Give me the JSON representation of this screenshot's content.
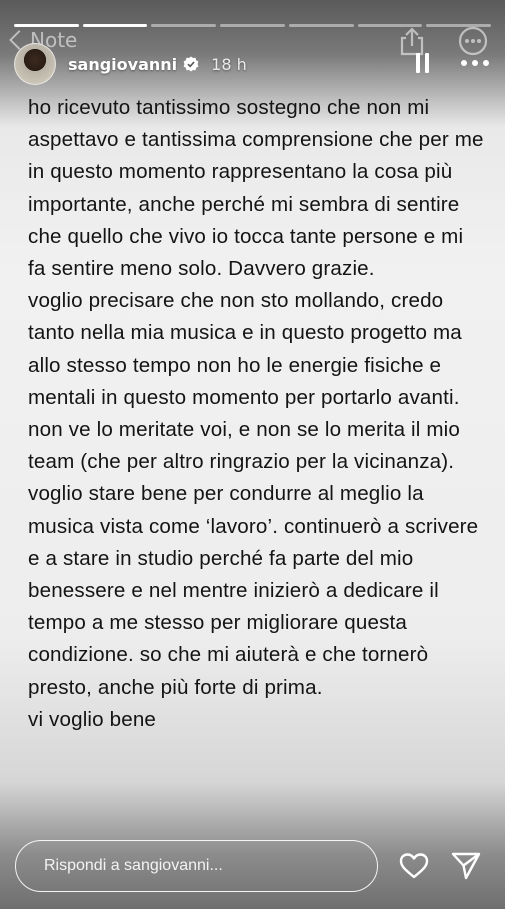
{
  "app": {
    "back_label": "Note"
  },
  "story": {
    "progress": [
      1,
      1,
      0,
      0,
      0,
      0,
      0
    ],
    "username": "sangiovanni",
    "time": "18 h"
  },
  "note": {
    "paragraphs": [
      "ho ricevuto tantissimo sostegno che non mi aspettavo e tantissima comprensione che per me in questo momento rappresentano la cosa più importante, anche perché mi sembra di sentire che quello che vivo io tocca tante persone e mi fa sentire meno solo. Davvero grazie.",
      "voglio precisare che non sto mollando, credo tanto nella mia musica e in questo progetto ma allo stesso tempo non ho le energie fisiche e mentali in questo momento per portarlo avanti. non ve lo meritate voi, e non se lo merita il mio team (che per altro ringrazio per la vicinanza). voglio stare bene per condurre al meglio la musica vista come ‘lavoro’. continuerò a scrivere e a stare in studio perché fa parte del mio benessere e nel mentre inizierò a dedicare il tempo a me stesso per migliorare questa condizione. so che mi aiuterà e che tornerò presto, anche più forte di prima.",
      "vi voglio bene"
    ]
  },
  "reply": {
    "placeholder": "Rispondi a sangiovanni..."
  }
}
